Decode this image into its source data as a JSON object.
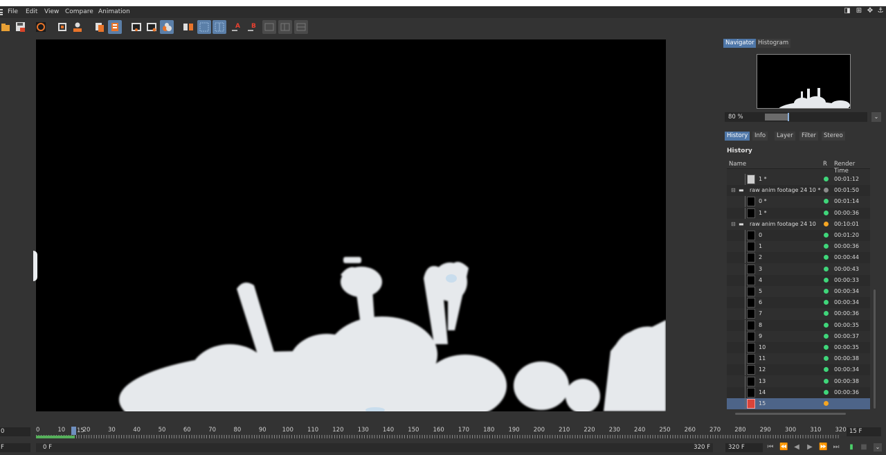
{
  "menu": [
    "File",
    "Edit",
    "View",
    "Compare",
    "Animation"
  ],
  "navigator": {
    "tabs": [
      "Navigator",
      "Histogram"
    ],
    "zoom_value": "80 %",
    "zoom_level": 0.22
  },
  "lower_tabs": [
    "History",
    "Info",
    "Layer",
    "Filter",
    "Stereo"
  ],
  "history": {
    "title": "History",
    "columns": {
      "name": "Name",
      "r": "R",
      "time": "Render Time"
    },
    "rows": [
      {
        "name": "1 *",
        "status": "green",
        "time": "00:01:12",
        "kind": "frame",
        "light": true
      },
      {
        "name": "raw anim footage 24 10 *",
        "status": "gray",
        "time": "00:01:50",
        "kind": "folder"
      },
      {
        "name": "0 *",
        "status": "green",
        "time": "00:01:14",
        "kind": "frame"
      },
      {
        "name": "1 *",
        "status": "green",
        "time": "00:00:36",
        "kind": "frame"
      },
      {
        "name": "raw anim footage 24 10",
        "status": "orange",
        "time": "00:10:01",
        "kind": "folder"
      },
      {
        "name": "0",
        "status": "green",
        "time": "00:01:20",
        "kind": "frame"
      },
      {
        "name": "1",
        "status": "green",
        "time": "00:00:36",
        "kind": "frame"
      },
      {
        "name": "2",
        "status": "green",
        "time": "00:00:44",
        "kind": "frame"
      },
      {
        "name": "3",
        "status": "green",
        "time": "00:00:43",
        "kind": "frame"
      },
      {
        "name": "4",
        "status": "green",
        "time": "00:00:33",
        "kind": "frame"
      },
      {
        "name": "5",
        "status": "green",
        "time": "00:00:34",
        "kind": "frame"
      },
      {
        "name": "6",
        "status": "green",
        "time": "00:00:34",
        "kind": "frame"
      },
      {
        "name": "7",
        "status": "green",
        "time": "00:00:36",
        "kind": "frame"
      },
      {
        "name": "8",
        "status": "green",
        "time": "00:00:35",
        "kind": "frame"
      },
      {
        "name": "9",
        "status": "green",
        "time": "00:00:37",
        "kind": "frame"
      },
      {
        "name": "10",
        "status": "green",
        "time": "00:00:35",
        "kind": "frame"
      },
      {
        "name": "11",
        "status": "green",
        "time": "00:00:38",
        "kind": "frame"
      },
      {
        "name": "12",
        "status": "green",
        "time": "00:00:34",
        "kind": "frame"
      },
      {
        "name": "13",
        "status": "green",
        "time": "00:00:38",
        "kind": "frame"
      },
      {
        "name": "14",
        "status": "green",
        "time": "00:00:36",
        "kind": "frame"
      },
      {
        "name": "15",
        "status": "orange",
        "time": "",
        "kind": "frame",
        "selected": true
      }
    ]
  },
  "timeline": {
    "ticks": [
      "0",
      "10",
      "20",
      "30",
      "40",
      "50",
      "60",
      "70",
      "80",
      "90",
      "100",
      "110",
      "120",
      "130",
      "140",
      "150",
      "160",
      "170",
      "180",
      "190",
      "200",
      "210",
      "220",
      "230",
      "240",
      "250",
      "260",
      "270",
      "280",
      "290",
      "300",
      "310",
      "320"
    ],
    "current_frame_label": "15",
    "current_frame_field": "15 F",
    "start_left": "0",
    "start_field": "0 F",
    "end_field": "320 F",
    "end_field_2": "320 F",
    "left_field_label": "F"
  },
  "colors": {
    "green": "#3fd67a",
    "orange": "#f5a623",
    "gray": "#8a8a8a",
    "accent": "#4f77a8"
  }
}
